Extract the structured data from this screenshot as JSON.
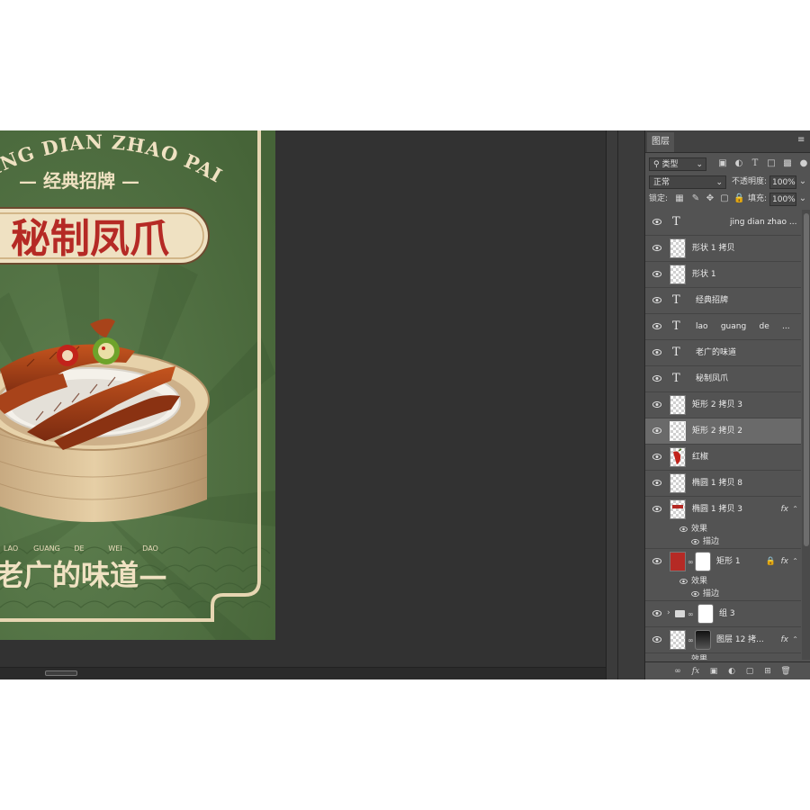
{
  "artwork": {
    "arc_text": "JING DIAN ZHAO PAI",
    "subtitle": "— 经典招牌 —",
    "main_title": "秘制凤爪",
    "pinyin": [
      "LAO",
      "GUANG",
      "DE",
      "WEI",
      "DAO"
    ],
    "slogan": "老广的味道—",
    "colors": {
      "background": "#4f7044",
      "frame": "#e7d6b2",
      "title_red": "#b52a25"
    }
  },
  "panel": {
    "tab_label": "图层",
    "filter_label": "类型",
    "blend_mode": "正常",
    "opacity_label": "不透明度:",
    "opacity_value": "100%",
    "lock_label": "锁定:",
    "fill_label": "填充:",
    "fill_value": "100%",
    "layers": [
      {
        "name": "jing dian zhao ...",
        "kind": "text"
      },
      {
        "name": "形状 1 拷贝",
        "kind": "shape"
      },
      {
        "name": "形状 1",
        "kind": "shape"
      },
      {
        "name": "经典招牌",
        "kind": "text"
      },
      {
        "name": "lao     guang     de     ...",
        "kind": "text"
      },
      {
        "name": "老广的味道",
        "kind": "text"
      },
      {
        "name": "秘制凤爪",
        "kind": "text"
      },
      {
        "name": "矩形 2 拷贝 3",
        "kind": "shape"
      },
      {
        "name": "矩形 2 拷贝 2",
        "kind": "shape",
        "selected": true
      },
      {
        "name": "红椒",
        "kind": "image"
      },
      {
        "name": "椭圆 1 拷贝 8",
        "kind": "shape"
      },
      {
        "name": "椭圆 1 拷贝 3",
        "kind": "shape",
        "fx": "fx",
        "effects": [
          "效果",
          "描边"
        ]
      },
      {
        "name": "矩形 1",
        "kind": "masked",
        "fx": "fx",
        "effects": [
          "效果",
          "描边"
        ]
      },
      {
        "name": "组 3",
        "kind": "group"
      },
      {
        "name": "图层 12 拷...",
        "kind": "masked",
        "fx": "fx"
      }
    ],
    "partial_row": "效果"
  }
}
